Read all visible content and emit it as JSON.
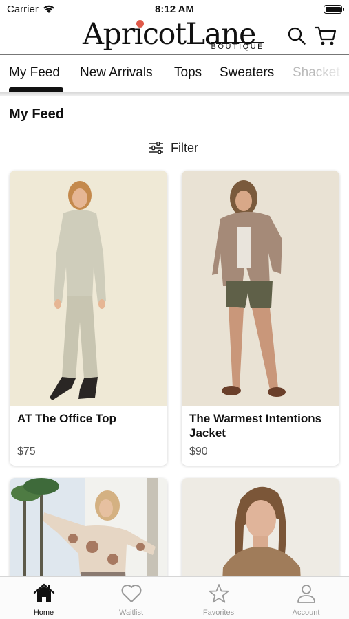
{
  "status_bar": {
    "carrier": "Carrier",
    "time": "8:12 AM"
  },
  "header": {
    "logo_main": "ApricotLane",
    "logo_sub": "BOUTIQUE",
    "icons": [
      "search-icon",
      "cart-icon"
    ]
  },
  "tabs": [
    {
      "label": "My Feed",
      "active": true
    },
    {
      "label": "New Arrivals"
    },
    {
      "label": "Tops"
    },
    {
      "label": "Sweaters"
    },
    {
      "label": "Shacket"
    }
  ],
  "feed": {
    "title": "My Feed",
    "filter_label": "Filter",
    "products": [
      {
        "title": "AT The Office Top",
        "price": "$75"
      },
      {
        "title": "The Warmest Intentions Jacket",
        "price": "$90"
      },
      {
        "title": "",
        "price": ""
      },
      {
        "title": "",
        "price": ""
      }
    ]
  },
  "tabbar": [
    {
      "label": "Home",
      "icon": "home-icon",
      "active": true
    },
    {
      "label": "Waitlist",
      "icon": "heart-icon"
    },
    {
      "label": "Favorites",
      "icon": "star-icon"
    },
    {
      "label": "Account",
      "icon": "person-icon"
    }
  ],
  "colors": {
    "accent": "#111111",
    "logo_dot": "#e05a4a",
    "inactive": "#9a9a9a"
  }
}
